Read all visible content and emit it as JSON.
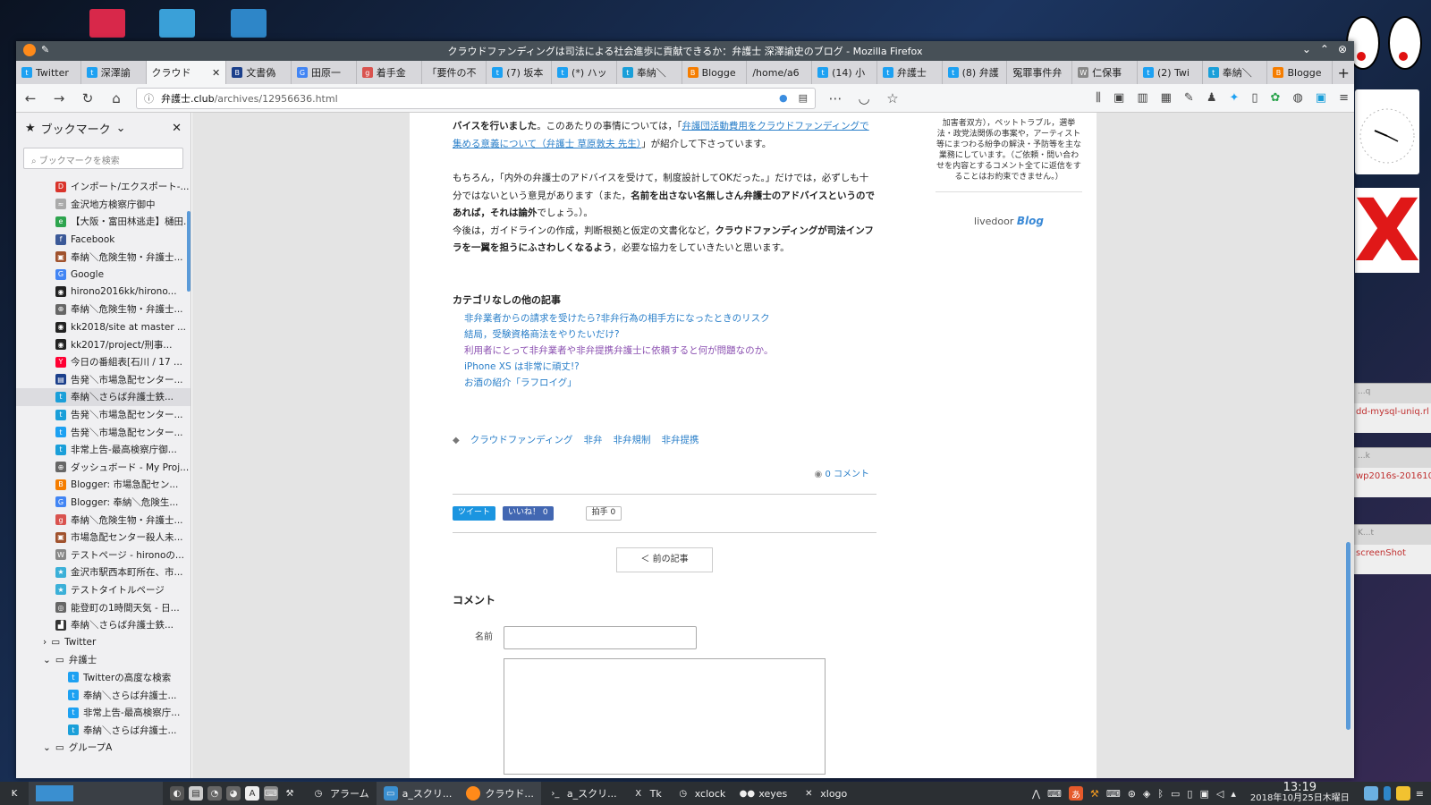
{
  "window": {
    "title": "クラウドファンディングは司法による社会進歩に貢献できるか：弁護士 深澤諭史のブログ - Mozilla Firefox"
  },
  "tabs": [
    {
      "label": "Twitter",
      "color": "#1da1f2",
      "glyph": "t"
    },
    {
      "label": "深澤諭",
      "color": "#1da1f2",
      "glyph": "t"
    },
    {
      "label": "クラウド",
      "color": "#ffffff",
      "glyph": "",
      "active": true
    },
    {
      "label": "文書偽",
      "color": "#1b3f8b",
      "glyph": "B"
    },
    {
      "label": "田原一",
      "color": "#4285f4",
      "glyph": "G"
    },
    {
      "label": "着手金",
      "color": "#d9534f",
      "glyph": "g"
    },
    {
      "label": "「要件の不",
      "color": "#ffffff",
      "glyph": ""
    },
    {
      "label": "(7) 坂本",
      "color": "#1da1f2",
      "glyph": "t"
    },
    {
      "label": "(*) ハッ",
      "color": "#1da1f2",
      "glyph": "t"
    },
    {
      "label": "奉納＼",
      "color": "#1a9fd9",
      "glyph": "t"
    },
    {
      "label": "Blogge",
      "color": "#f57d00",
      "glyph": "B"
    },
    {
      "label": "/home/a6",
      "color": "#ffffff",
      "glyph": ""
    },
    {
      "label": "(14) 小",
      "color": "#1da1f2",
      "glyph": "t"
    },
    {
      "label": "弁護士",
      "color": "#1da1f2",
      "glyph": "t"
    },
    {
      "label": "(8) 弁護",
      "color": "#1da1f2",
      "glyph": "t"
    },
    {
      "label": "冤罪事件弁",
      "color": "#ffffff",
      "glyph": ""
    },
    {
      "label": "仁保事",
      "color": "#ffffff",
      "glyph": "W"
    },
    {
      "label": "(2) Twi",
      "color": "#1da1f2",
      "glyph": "t"
    },
    {
      "label": "奉納＼",
      "color": "#1a9fd9",
      "glyph": "t"
    },
    {
      "label": "Blogge",
      "color": "#f57d00",
      "glyph": "B"
    }
  ],
  "url": {
    "domain": "弁護士.club",
    "path": "/archives/12956636.html"
  },
  "sidebar": {
    "title": "ブックマーク",
    "search_placeholder": "ブックマークを検索",
    "items": [
      {
        "label": "インポート/エクスポート-...",
        "color": "#d9342b",
        "glyph": "D"
      },
      {
        "label": "金沢地方検察庁御中",
        "color": "#aaaaaa",
        "glyph": "≈"
      },
      {
        "label": "【大阪・富田林逃走】樋田...",
        "color": "#2da44e",
        "glyph": "e"
      },
      {
        "label": "Facebook",
        "color": "#3b5998",
        "glyph": "f"
      },
      {
        "label": "奉納＼危険生物・弁護士...",
        "color": "#a0522d",
        "glyph": "▣"
      },
      {
        "label": "Google",
        "color": "#4285f4",
        "glyph": "G"
      },
      {
        "label": "hirono2016kk/hirono...",
        "color": "#222222",
        "glyph": "◉"
      },
      {
        "label": "奉納＼危険生物・弁護士...",
        "color": "#666666",
        "glyph": "⊕"
      },
      {
        "label": "kk2018/site at master ...",
        "color": "#222222",
        "glyph": "◉"
      },
      {
        "label": "kk2017/project/刑事...",
        "color": "#222222",
        "glyph": "◉"
      },
      {
        "label": "今日の番組表[石川 / 17 ...",
        "color": "#ff0033",
        "glyph": "Y"
      },
      {
        "label": "告発＼市場急配センター...",
        "color": "#1b3f8b",
        "glyph": "▤"
      },
      {
        "label": "奉納＼さらば弁護士鉄...",
        "color": "#1a9fd9",
        "glyph": "t",
        "selected": true
      },
      {
        "label": "告発＼市場急配センター...",
        "color": "#1a9fd9",
        "glyph": "t"
      },
      {
        "label": "告発＼市場急配センター...",
        "color": "#1da1f2",
        "glyph": "t"
      },
      {
        "label": "非常上告-最高検察庁御...",
        "color": "#1a9fd9",
        "glyph": "t"
      },
      {
        "label": "ダッシュボード - My Proj...",
        "color": "#666666",
        "glyph": "⊕"
      },
      {
        "label": "Blogger: 市場急配セン...",
        "color": "#f57d00",
        "glyph": "B"
      },
      {
        "label": "Blogger: 奉納＼危険生...",
        "color": "#4285f4",
        "glyph": "G"
      },
      {
        "label": "奉納＼危険生物・弁護士...",
        "color": "#d9534f",
        "glyph": "g"
      },
      {
        "label": "市場急配センター殺人未...",
        "color": "#a0522d",
        "glyph": "▣"
      },
      {
        "label": "テストページ - hironoの...",
        "color": "#888888",
        "glyph": "W"
      },
      {
        "label": "金沢市駅西本町所在、市...",
        "color": "#3bb0d8",
        "glyph": "★"
      },
      {
        "label": "テストタイトルページ",
        "color": "#3bb0d8",
        "glyph": "★"
      },
      {
        "label": "能登町の1時間天気 - 日...",
        "color": "#666666",
        "glyph": "◎"
      },
      {
        "label": "奉納＼さらば弁護士鉄...",
        "color": "#333333",
        "glyph": "▟"
      }
    ],
    "folders": [
      {
        "label": "Twitter",
        "arrow": "›"
      },
      {
        "label": "弁護士",
        "arrow": "⌄"
      }
    ],
    "subitems": [
      {
        "label": "Twitterの高度な検索",
        "color": "#1da1f2",
        "glyph": "t"
      },
      {
        "label": "奉納＼さらば弁護士...",
        "color": "#1da1f2",
        "glyph": "t"
      },
      {
        "label": "非常上告-最高検察庁...",
        "color": "#1da1f2",
        "glyph": "t"
      },
      {
        "label": "奉納＼さらば弁護士...",
        "color": "#1a9fd9",
        "glyph": "t"
      }
    ],
    "last_folder": "グループA"
  },
  "article": {
    "p1_a": "バイスを行いました",
    "p1_b": "。このあたりの事情については，「",
    "p1_link": "弁護団活動費用をクラウドファンディングで集める意義について（弁護士 草原敦夫 先生）",
    "p1_c": "」が紹介して下さっています。",
    "p2_a": "もちろん，「内外の弁護士のアドバイスを受けて，制度設計してOKだった。」だけでは，必ずしも十分ではないという意見があります（また，",
    "p2_b": "名前を出さない名無しさん弁護士のアドバイスというのであれば，それは論外",
    "p2_c": "でしょう。）。",
    "p3_a": "今後は，ガイドラインの作成，判断根拠と仮定の文書化など，",
    "p3_b": "クラウドファンディングが司法インフラを一翼を担うにふさわしくなるよう",
    "p3_c": "，必要な協力をしていきたいと思います。"
  },
  "others": {
    "heading": "カテゴリなしの他の記事",
    "items": [
      "非弁業者からの請求を受けたら?非弁行為の相手方になったときのリスク",
      "結局，受験資格商法をやりたいだけ?",
      "利用者にとって非弁業者や非弁提携弁護士に依頼すると何が問題なのか。",
      "iPhone XS は非常に頑丈!?",
      "お酒の紹介「ラフロイグ」"
    ]
  },
  "tags": [
    "クラウドファンディング",
    "非弁",
    "非弁規制",
    "非弁提携"
  ],
  "comment_count": "0 コメント",
  "share": {
    "tweet": "ツイート",
    "like": "いいね！ 0",
    "clap": "拍手 0"
  },
  "prev_label": "＜ 前の記事",
  "comment": {
    "heading": "コメント",
    "name_label": "名前"
  },
  "right_col": {
    "text": "加害者双方），ペットトラブル，選挙法・政党法関係の事案や，アーティスト等にまつわる紛争の解決・予防等を主な業務にしています。（ご依頼・問い合わせを内容とするコメント全てに返信をすることはお約束できません。）",
    "logo_a": "livedoor",
    "logo_b": "Blog"
  },
  "side_windows": [
    {
      "title": "...q",
      "text": "dd-mysql-uniq.rl"
    },
    {
      "title": "...k",
      "text": "wp2016s-201610"
    },
    {
      "title": "K...t",
      "text": "screenShot"
    }
  ],
  "taskbar": {
    "items": [
      {
        "label": "アラーム",
        "name": "alarm"
      },
      {
        "label": "a_スクリ...",
        "name": "a-script-1",
        "active": true
      },
      {
        "label": "クラウド...",
        "name": "firefox"
      },
      {
        "label": "a_スクリ...",
        "name": "a-script-2"
      },
      {
        "label": "Tk",
        "name": "tk"
      },
      {
        "label": "xclock",
        "name": "xclock"
      },
      {
        "label": "xeyes",
        "name": "xeyes"
      },
      {
        "label": "xlogo",
        "name": "xlogo"
      }
    ],
    "time": "13:19",
    "date": "2018年10月25日木曜日",
    "ime": "あ"
  }
}
